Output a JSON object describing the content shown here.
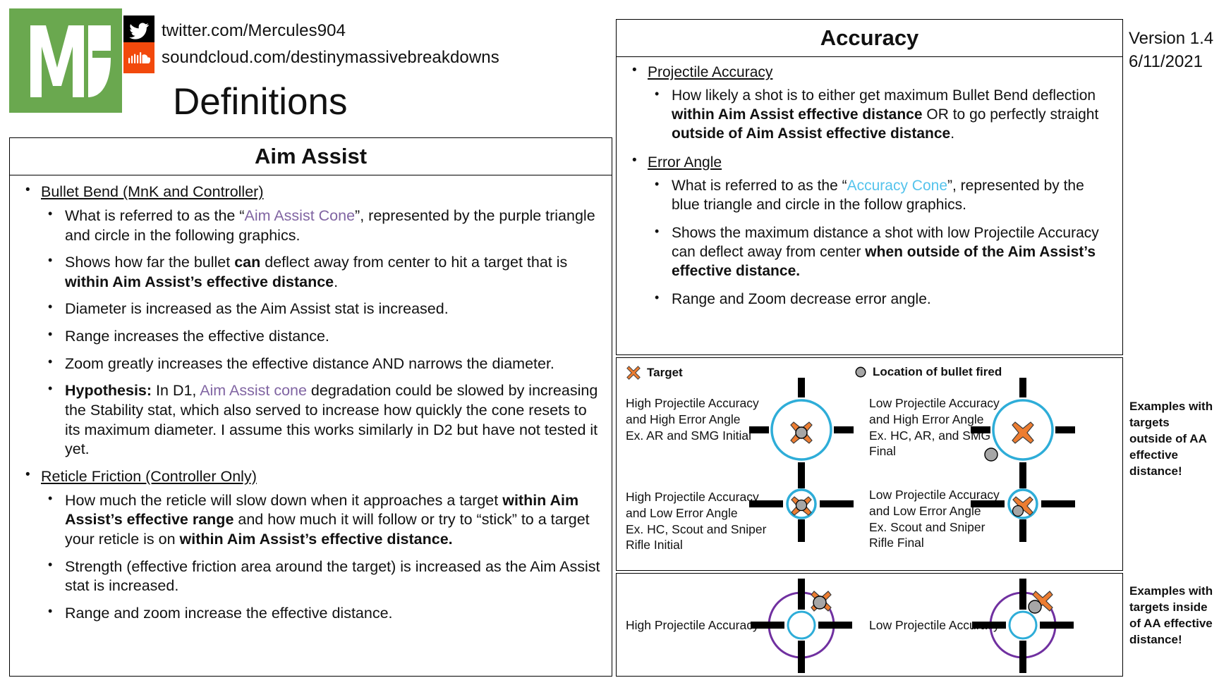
{
  "branding": {
    "logo_text": "MB",
    "logo_color": "#6aa84f",
    "social": [
      {
        "icon": "twitter-icon",
        "text": "twitter.com/Mercules904",
        "bg": "#000000"
      },
      {
        "icon": "soundcloud-icon",
        "text": "soundcloud.com/destinymassivebreakdowns",
        "bg": "#f2490c"
      }
    ]
  },
  "page_title": "Definitions",
  "version": {
    "version_label": "Version 1.4",
    "date_label": "6/11/2021"
  },
  "colors": {
    "aim_assist_cone": "#8064a2",
    "accuracy_cone": "#54c3ec",
    "target_orange": "#ed7d31",
    "bullet_gray": "#a6a6a6",
    "purple_circle": "#7030a0",
    "cyan_circle": "#2eadd8"
  },
  "left_panel": {
    "title": "Aim Assist",
    "sections": [
      {
        "heading": "Bullet Bend (MnK and Controller)",
        "bullets": [
          {
            "parts": [
              {
                "t": "What is referred to as the “"
              },
              {
                "t": "Aim Assist Cone",
                "style": "purple"
              },
              {
                "t": "”, represented by the purple triangle and circle in the following graphics."
              }
            ]
          },
          {
            "parts": [
              {
                "t": "Shows how far the bullet "
              },
              {
                "t": "can",
                "style": "bold"
              },
              {
                "t": " deflect away from center to hit a target that is "
              },
              {
                "t": "within Aim Assist’s effective distance",
                "style": "bold"
              },
              {
                "t": "."
              }
            ]
          },
          {
            "parts": [
              {
                "t": "Diameter is increased as the Aim Assist stat is increased."
              }
            ]
          },
          {
            "parts": [
              {
                "t": "Range increases the effective distance."
              }
            ]
          },
          {
            "parts": [
              {
                "t": "Zoom greatly increases the effective distance AND narrows the diameter."
              }
            ]
          },
          {
            "parts": [
              {
                "t": "Hypothesis:",
                "style": "bold"
              },
              {
                "t": " In D1, "
              },
              {
                "t": "Aim Assist cone",
                "style": "purple"
              },
              {
                "t": " degradation could be slowed by increasing the Stability stat, which also served to increase how quickly the cone resets to its maximum diameter. I assume this works similarly in D2 but have not tested it yet."
              }
            ]
          }
        ]
      },
      {
        "heading": "Reticle Friction (Controller Only)",
        "bullets": [
          {
            "parts": [
              {
                "t": "How much the reticle will slow down when it approaches a target "
              },
              {
                "t": "within Aim Assist’s effective range",
                "style": "bold"
              },
              {
                "t": " and how much it will follow or try to “stick” to a target your reticle is on "
              },
              {
                "t": "within Aim Assist’s effective distance.",
                "style": "bold"
              }
            ]
          },
          {
            "parts": [
              {
                "t": "Strength (effective friction area around the target) is increased as the Aim Assist stat is increased."
              }
            ]
          },
          {
            "parts": [
              {
                "t": "Range and zoom increase the effective distance."
              }
            ]
          }
        ]
      }
    ]
  },
  "accuracy_panel": {
    "title": "Accuracy",
    "sections": [
      {
        "heading": "Projectile Accuracy",
        "bullets": [
          {
            "parts": [
              {
                "t": "How likely a shot is to either get maximum Bullet Bend deflection "
              },
              {
                "t": "within Aim Assist effective distance",
                "style": "bold"
              },
              {
                "t": " OR to go perfectly straight "
              },
              {
                "t": "outside of Aim Assist effective distance",
                "style": "bold"
              },
              {
                "t": "."
              }
            ]
          }
        ]
      },
      {
        "heading": "Error Angle",
        "bullets": [
          {
            "parts": [
              {
                "t": "What is referred to as the “"
              },
              {
                "t": "Accuracy Cone",
                "style": "blue"
              },
              {
                "t": "”, represented by the blue triangle and circle in the follow graphics."
              }
            ]
          },
          {
            "parts": [
              {
                "t": "Shows the maximum distance a shot with low Projectile Accuracy can deflect away from center "
              },
              {
                "t": "when outside of the Aim Assist’s effective distance.",
                "style": "bold"
              }
            ]
          },
          {
            "parts": [
              {
                "t": "Range and Zoom decrease error angle."
              }
            ]
          }
        ]
      }
    ]
  },
  "diagram": {
    "legend": [
      {
        "icon": "target-x-icon",
        "label": "Target"
      },
      {
        "icon": "bullet-circle-icon",
        "label": "Location of bullet fired"
      }
    ],
    "cells": [
      {
        "id": "cell-top-left",
        "label": "High Projectile Accuracy\nand High Error Angle\nEx. AR and SMG Initial"
      },
      {
        "id": "cell-top-right",
        "label": "Low Projectile Accuracy\nand High Error Angle\nEx. HC, AR, and SMG\nFinal"
      },
      {
        "id": "cell-mid-left",
        "label": "High Projectile Accuracy\nand Low Error Angle\nEx. HC, Scout and Sniper\nRifle Initial"
      },
      {
        "id": "cell-mid-right",
        "label": "Low Projectile Accuracy\nand Low Error Angle\nEx. Scout and Sniper\nRifle Final"
      },
      {
        "id": "cell-bot-left",
        "label": "High Projectile Accuracy"
      },
      {
        "id": "cell-bot-right",
        "label": "Low Projectile Accuracy"
      }
    ]
  },
  "notes": {
    "outside": "Examples with targets outside of AA effective distance!",
    "inside": "Examples with targets inside of AA effective distance!"
  }
}
